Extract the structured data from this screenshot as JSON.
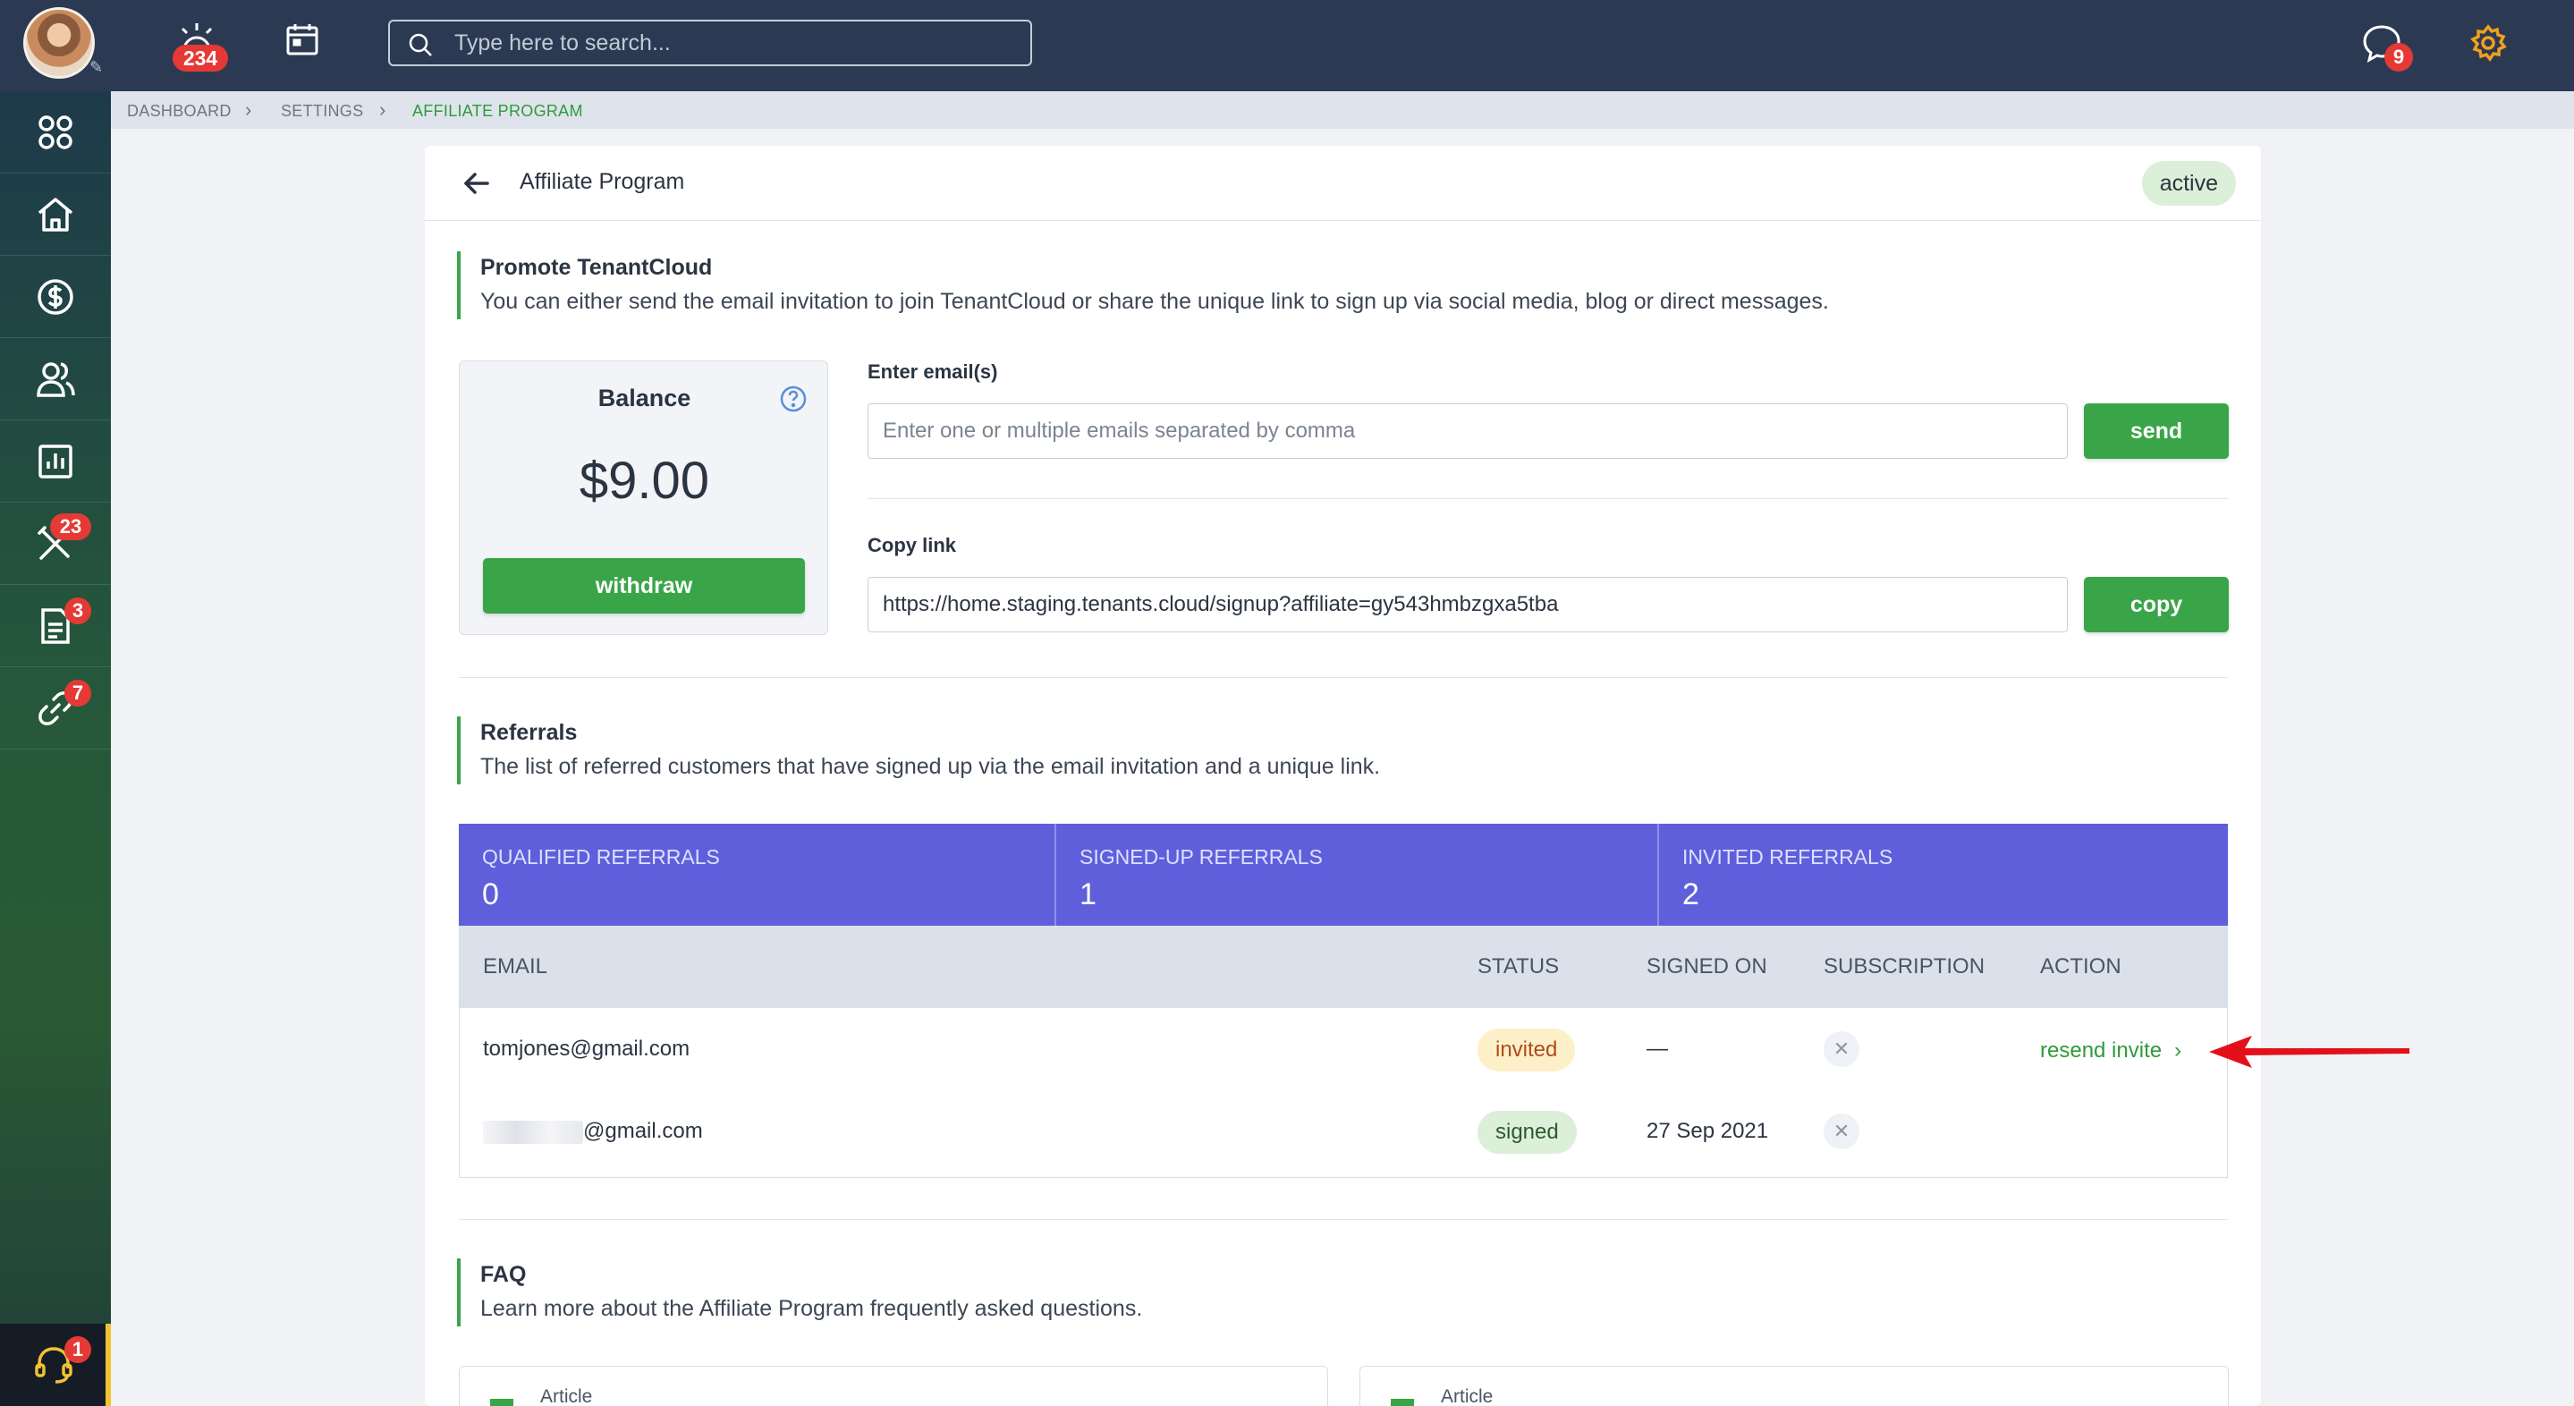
{
  "topbar": {
    "notifications_count": "234",
    "search_placeholder": "Type here to search...",
    "messages_count": "9"
  },
  "sidebar": {
    "maintenance_count": "23",
    "documents_count": "3",
    "links_count": "7",
    "support_count": "1"
  },
  "breadcrumb": [
    "DASHBOARD",
    "SETTINGS",
    "AFFILIATE PROGRAM"
  ],
  "page": {
    "title": "Affiliate Program",
    "status": "active"
  },
  "promote": {
    "title": "Promote TenantCloud",
    "description": "You can either send the email invitation to join TenantCloud or share the unique link to sign up via social media, blog or direct messages."
  },
  "balance": {
    "label": "Balance",
    "amount": "$9.00",
    "withdraw_label": "withdraw"
  },
  "email_invite": {
    "label": "Enter email(s)",
    "placeholder": "Enter one or multiple emails separated by comma",
    "send_label": "send"
  },
  "copy_link": {
    "label": "Copy link",
    "value": "https://home.staging.tenants.cloud/signup?affiliate=gy543hmbzgxa5tba",
    "copy_label": "copy"
  },
  "referrals": {
    "title": "Referrals",
    "description": "The list of referred customers that have signed up via the email invitation and a unique link.",
    "stats": [
      {
        "label": "QUALIFIED REFERRALS",
        "value": "0"
      },
      {
        "label": "SIGNED-UP REFERRALS",
        "value": "1"
      },
      {
        "label": "INVITED REFERRALS",
        "value": "2"
      }
    ],
    "columns": [
      "EMAIL",
      "STATUS",
      "SIGNED ON",
      "SUBSCRIPTION",
      "ACTION"
    ],
    "rows": [
      {
        "email": "tomjones@gmail.com",
        "status": "invited",
        "signed_on": "—",
        "action": "resend invite"
      },
      {
        "email": "@gmail.com",
        "status": "signed",
        "signed_on": "27 Sep 2021",
        "action": ""
      }
    ]
  },
  "faq": {
    "title": "FAQ",
    "description": "Learn more about the Affiliate Program frequently asked questions.",
    "articles": [
      {
        "label": "Article"
      },
      {
        "label": "Article"
      }
    ]
  },
  "colors": {
    "brand_green": "#3aa548",
    "stats_purple": "#5f5fdc",
    "topbar": "#2b3a52",
    "badge_red": "#e53935",
    "settings_orange": "#f0a020"
  }
}
